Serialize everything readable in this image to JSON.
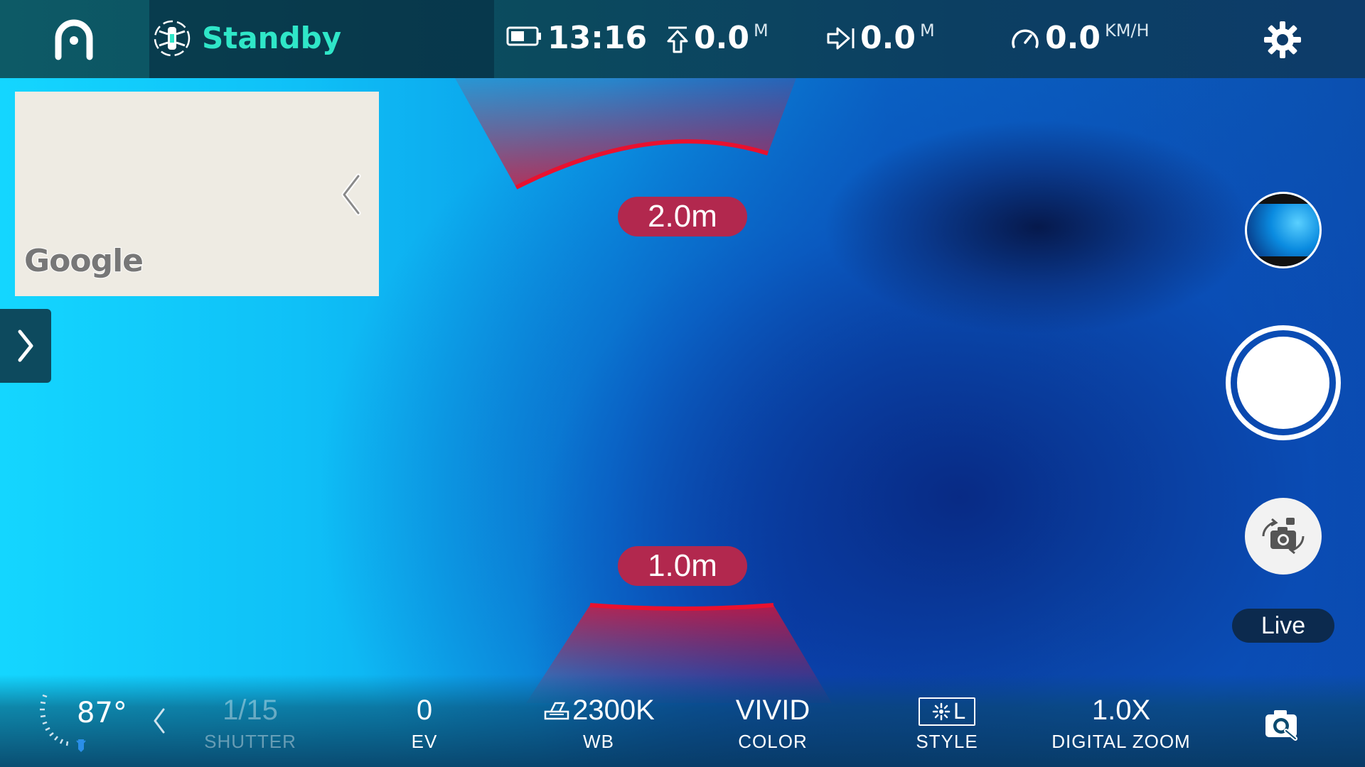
{
  "status": {
    "text": "Standby",
    "accent_color": "#2fe6c8"
  },
  "telemetry": {
    "battery": {
      "icon": "battery-icon",
      "value": "13:16"
    },
    "altitude": {
      "icon": "altitude-up-arrow-icon",
      "value": "0.0",
      "unit": "M"
    },
    "distance": {
      "icon": "distance-arrow-icon",
      "value": "0.0",
      "unit": "M"
    },
    "speed": {
      "icon": "speedometer-icon",
      "value": "0.0",
      "unit": "KM/H"
    }
  },
  "map": {
    "logo_text": "Google"
  },
  "sensors": {
    "top_distance": "2.0m",
    "bottom_distance": "1.0m",
    "warning_color": "#e8112f"
  },
  "controls": {
    "live_label": "Live"
  },
  "camera": {
    "gimbal_angle": "87°",
    "shutter": {
      "value": "1/15",
      "label": "SHUTTER"
    },
    "ev": {
      "value": "0",
      "label": "EV"
    },
    "wb": {
      "value": "2300K",
      "label": "WB"
    },
    "color": {
      "value": "VIVID",
      "label": "COLOR"
    },
    "style": {
      "value": "L",
      "label": "STYLE"
    },
    "zoom": {
      "value": "1.0X",
      "label": "DIGITAL ZOOM"
    }
  }
}
